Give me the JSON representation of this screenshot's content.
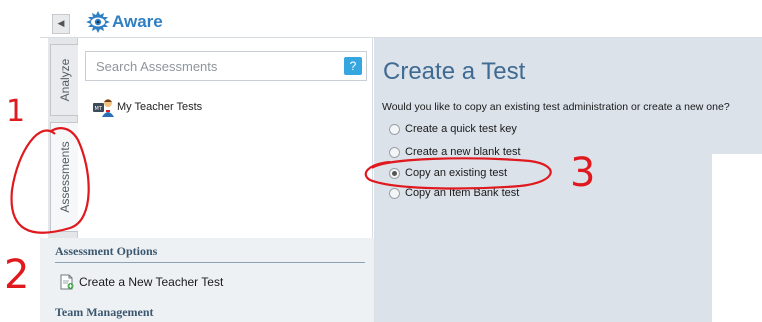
{
  "app": {
    "logo_text": "Aware"
  },
  "topbar": {
    "collapse_icon": "chevron-left-icon"
  },
  "tabs": [
    {
      "label": "Analyze",
      "active": false
    },
    {
      "label": "Assessments",
      "active": true
    }
  ],
  "search": {
    "placeholder": "Search Assessments",
    "value": "",
    "help_label": "?"
  },
  "tree": {
    "items": [
      {
        "label": "My Teacher Tests",
        "icon": "teacher-avatar-icon"
      }
    ]
  },
  "main": {
    "title": "Create a Test",
    "question": "Would you like to copy an existing test administration or create a new one?",
    "options": [
      {
        "label": "Create a quick test key",
        "selected": false
      },
      {
        "label": "Create a new blank test",
        "selected": false
      },
      {
        "label": "Copy an existing test",
        "selected": true
      },
      {
        "label": "Copy an Item Bank test",
        "selected": false
      }
    ]
  },
  "bottom": {
    "assessment_options_heading": "Assessment Options",
    "create_new_label": "Create a New Teacher Test",
    "team_management_heading": "Team Management"
  },
  "annotations": {
    "one": "1",
    "two": "2",
    "three": "3",
    "color": "#e0191e"
  },
  "colors": {
    "accent": "#2f7fc2",
    "title": "#3f6a91",
    "panel": "#dbe2ea",
    "help": "#35a6e0"
  }
}
